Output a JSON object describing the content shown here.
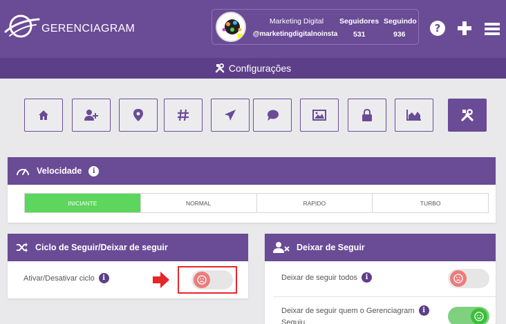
{
  "header": {
    "brand": "GERENCIAGRAM",
    "profile": {
      "name": "Marketing Digital",
      "handle": "@marketingdigitalnoinsta",
      "followers_label": "Seguidores",
      "followers": "531",
      "following_label": "Seguindo",
      "following": "936"
    },
    "icons": [
      "help-icon",
      "add-icon",
      "menu-icon"
    ]
  },
  "subheader": {
    "title": "Configurações"
  },
  "nav": {
    "items": [
      "home-icon",
      "add-user-icon",
      "location-icon",
      "hashtag-icon",
      "send-icon",
      "comment-icon",
      "image-icon",
      "lock-icon",
      "chart-icon",
      "tools-icon"
    ],
    "active": "tools-icon"
  },
  "velocidade": {
    "title": "Velocidade",
    "options": [
      "INICIANTE",
      "NORMAL",
      "RAPIDO",
      "TURBO"
    ],
    "selected": "INICIANTE"
  },
  "ciclo": {
    "title": "Ciclo de Seguir/Deixar de seguir",
    "toggle_label": "Ativar/Desativar ciclo",
    "toggle_on": false
  },
  "deixar": {
    "title": "Deixar de Seguir",
    "rows": [
      {
        "label": "Deixar de seguir todos",
        "on": false
      },
      {
        "label": "Deixar de seguir quem o Gerenciagram",
        "label2": "Seguiu",
        "on": true
      }
    ]
  },
  "colors": {
    "primary": "#6a4b96",
    "primary_dark": "#5d3f89",
    "selected": "#5cd65c",
    "highlight": "#e5262a"
  }
}
